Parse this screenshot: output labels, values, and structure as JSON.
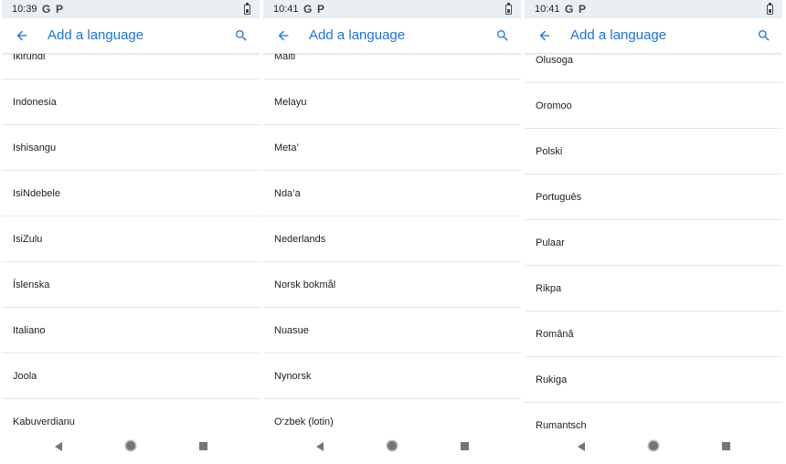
{
  "screens": [
    {
      "status_time": "10:39",
      "status_icon_1": "G",
      "status_icon_2": "P",
      "title": "Add a language",
      "languages": [
        "Ikirundi",
        "Indonesia",
        "Ishisangu",
        "IsiNdebele",
        "IsiZulu",
        "Íslenska",
        "Italiano",
        "Joola",
        "Kabuverdianu"
      ]
    },
    {
      "status_time": "10:41",
      "status_icon_1": "G",
      "status_icon_2": "P",
      "title": "Add a language",
      "languages": [
        "Malti",
        "Melayu",
        "Meta’",
        "Nda’a",
        "Nederlands",
        "Norsk bokmål",
        "Nuasue",
        "Nynorsk",
        "O‘zbek (lotin)"
      ]
    },
    {
      "status_time": "10:41",
      "status_icon_1": "G",
      "status_icon_2": "P",
      "title": "Add a language",
      "languages": [
        "Olusoga",
        "Oromoo",
        "Polski",
        "Português",
        "Pulaar",
        "Rikpa",
        "Română",
        "Rukiga",
        "Rumantsch"
      ]
    }
  ],
  "icons": {
    "back": "arrow-back-icon",
    "search": "search-icon",
    "battery": "battery-icon",
    "nav_back": "nav-back-icon",
    "nav_home": "nav-home-icon",
    "nav_recents": "nav-recents-icon"
  },
  "colors": {
    "accent": "#1a73e8",
    "status_bar": "#eceff1",
    "divider": "#e6e6e6"
  }
}
